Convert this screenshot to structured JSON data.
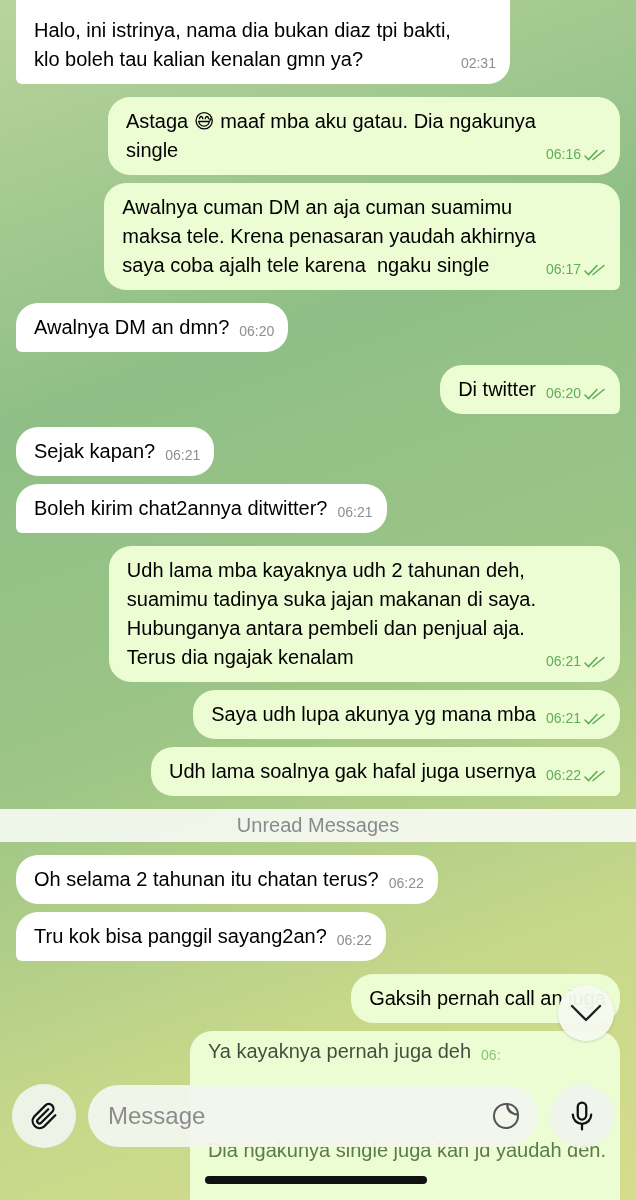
{
  "messages": [
    {
      "outgoing": false,
      "text": "Halo, ini istrinya, nama dia bukan diaz tpi bakti,\nklo boleh tau kalian kenalan gmn ya?",
      "time": "02:31"
    },
    {
      "outgoing": true,
      "text": "Astaga 😅 maaf mba aku gatau. Dia ngakunya\nsingle",
      "time": "06:16",
      "read": true
    },
    {
      "outgoing": true,
      "text": "Awalnya cuman DM an aja cuman suamimu\nmaksa tele. Krena penasaran yaudah akhirnya\nsaya coba ajalh tele karena  ngaku single",
      "time": "06:17",
      "read": true
    },
    {
      "outgoing": false,
      "text": "Awalnya DM an dmn?",
      "time": "06:20"
    },
    {
      "outgoing": true,
      "text": "Di twitter",
      "time": "06:20",
      "read": true
    },
    {
      "outgoing": false,
      "text": "Sejak kapan?",
      "time": "06:21"
    },
    {
      "outgoing": false,
      "text": "Boleh kirim chat2annya ditwitter?",
      "time": "06:21"
    },
    {
      "outgoing": true,
      "text": "Udh lama mba kayaknya udh 2 tahunan deh,\nsuamimu tadinya suka jajan makanan di saya.\nHubunganya antara pembeli dan penjual aja.\nTerus dia ngajak kenalam",
      "time": "06:21",
      "read": true
    },
    {
      "outgoing": true,
      "text": "Saya udh lupa akunya yg mana mba",
      "time": "06:21",
      "read": true
    },
    {
      "outgoing": true,
      "text": "Udh lama soalnya gak hafal juga usernya",
      "time": "06:22",
      "read": true
    },
    {
      "kind": "divider",
      "text": "Unread Messages"
    },
    {
      "outgoing": false,
      "text": "Oh selama 2 tahunan itu chatan terus?",
      "time": "06:22"
    },
    {
      "outgoing": false,
      "text": "Tru kok bisa panggil sayang2an?",
      "time": "06:22"
    },
    {
      "outgoing": true,
      "text": "Gaksih pernah call an juga"
    },
    {
      "outgoing": true,
      "kind": "covered",
      "text": "Ya kayaknya pernah juga deh",
      "time": "06:",
      "lower_text": "Dia ngakunya single juga kan jd yaudah deh."
    }
  ],
  "composer": {
    "placeholder": "Message"
  }
}
